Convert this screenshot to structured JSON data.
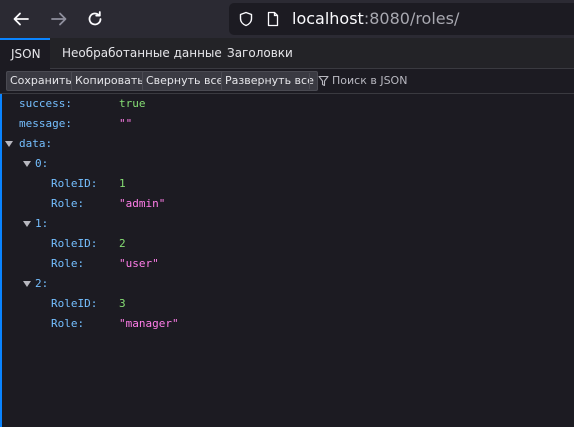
{
  "url": {
    "host": "localhost",
    "rest": ":8080/roles/"
  },
  "tabs": [
    "JSON",
    "Необработанные данные",
    "Заголовки"
  ],
  "actions": {
    "save": "Сохранить",
    "copy": "Копировать",
    "collapse": "Свернуть все",
    "expand": "Развернуть все",
    "filter_placeholder": "Поиск в JSON"
  },
  "json": {
    "success_key": "success:",
    "success_val": "true",
    "message_key": "message:",
    "message_val": "\"\"",
    "data_key": "data:",
    "items": [
      {
        "index": "0:",
        "roleid_key": "RoleID:",
        "roleid": "1",
        "role_key": "Role:",
        "role": "\"admin\""
      },
      {
        "index": "1:",
        "roleid_key": "RoleID:",
        "roleid": "2",
        "role_key": "Role:",
        "role": "\"user\""
      },
      {
        "index": "2:",
        "roleid_key": "RoleID:",
        "roleid": "3",
        "role_key": "Role:",
        "role": "\"manager\""
      }
    ]
  },
  "colors": {
    "accent": "#0a84ff",
    "key": "#75bfff",
    "string": "#ff7de9",
    "number": "#86de74"
  }
}
